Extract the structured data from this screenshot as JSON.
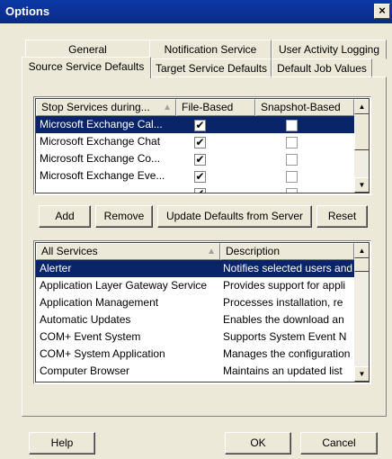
{
  "window": {
    "title": "Options",
    "close_glyph": "×"
  },
  "tabs_row1": [
    {
      "label": "General"
    },
    {
      "label": "Notification Service"
    },
    {
      "label": "User Activity Logging"
    }
  ],
  "tabs_row2": [
    {
      "label": "Source Service Defaults",
      "active": true
    },
    {
      "label": "Target Service Defaults"
    },
    {
      "label": "Default Job Values"
    }
  ],
  "stop_services": {
    "columns": [
      "Stop Services during...",
      "File-Based",
      "Snapshot-Based"
    ],
    "sort_glyph": "▲",
    "rows": [
      {
        "name": "Microsoft Exchange Cal...",
        "file_based": true,
        "snapshot_based": false,
        "selected": true
      },
      {
        "name": "Microsoft Exchange Chat",
        "file_based": true,
        "snapshot_based": false
      },
      {
        "name": "Microsoft Exchange Co...",
        "file_based": true,
        "snapshot_based": false
      },
      {
        "name": "Microsoft Exchange Eve...",
        "file_based": true,
        "snapshot_based": false
      }
    ]
  },
  "buttons": {
    "add": "Add",
    "remove": "Remove",
    "update_defaults": "Update Defaults from Server",
    "reset": "Reset",
    "help": "Help",
    "ok": "OK",
    "cancel": "Cancel"
  },
  "all_services": {
    "columns": [
      "All Services",
      "Description"
    ],
    "sort_glyph": "▲",
    "rows": [
      {
        "name": "Alerter",
        "description": "Notifies selected users and",
        "selected": true
      },
      {
        "name": "Application Layer Gateway Service",
        "description": "Provides support for appli"
      },
      {
        "name": "Application Management",
        "description": "Processes installation, re"
      },
      {
        "name": "Automatic Updates",
        "description": "Enables the download an"
      },
      {
        "name": "COM+ Event System",
        "description": "Supports System Event N"
      },
      {
        "name": "COM+ System Application",
        "description": "Manages the configuration"
      },
      {
        "name": "Computer Browser",
        "description": "Maintains an updated list"
      }
    ]
  },
  "icons": {
    "check": "✔",
    "scroll_up": "▲",
    "scroll_down": "▼"
  }
}
